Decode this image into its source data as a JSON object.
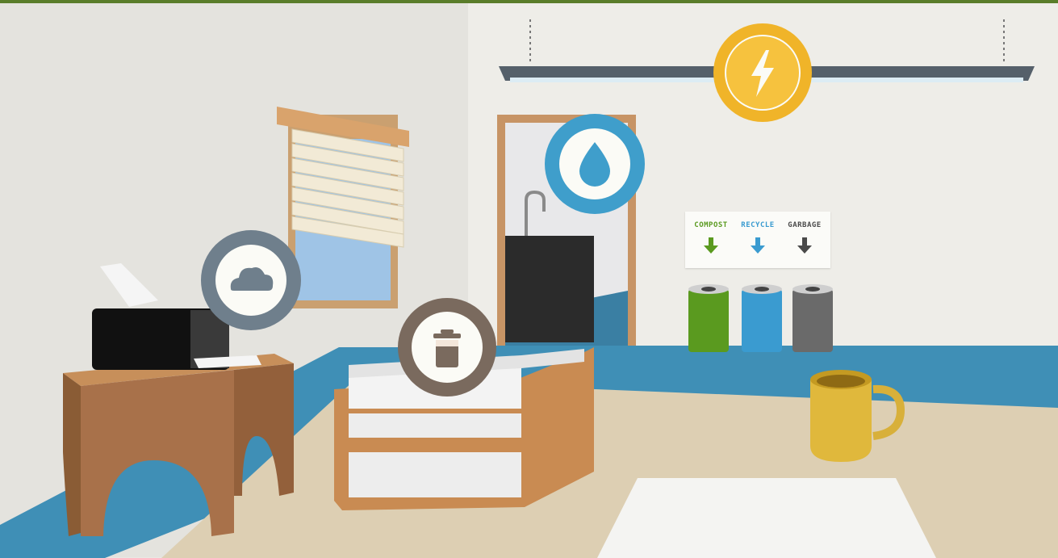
{
  "scene": {
    "frame_color": "#5a7d2a",
    "hotspots": [
      {
        "id": "energy",
        "icon": "lightning-icon",
        "ring": "#f0b429",
        "inner": "#fbfbf6"
      },
      {
        "id": "water",
        "icon": "water-drop-icon",
        "ring": "#3f9ecb",
        "inner": "#fbfbf6"
      },
      {
        "id": "cloud",
        "icon": "cloud-icon",
        "ring": "#6f7f8c",
        "inner": "#fbfbf6"
      },
      {
        "id": "waste",
        "icon": "bin-icon",
        "ring": "#7a6a5e",
        "inner": "#fbfbf6"
      }
    ],
    "bin_sign": {
      "compost": {
        "label": "COMPOST",
        "color": "#5a9a1f"
      },
      "recycle": {
        "label": "RECYCLE",
        "color": "#3a9bd0"
      },
      "garbage": {
        "label": "GARBAGE",
        "color": "#4a4a4a"
      }
    },
    "bins": [
      {
        "name": "compost",
        "color": "#5a9a1f"
      },
      {
        "name": "recycle",
        "color": "#3a9bd0"
      },
      {
        "name": "garbage",
        "color": "#6a6a6a"
      }
    ]
  }
}
